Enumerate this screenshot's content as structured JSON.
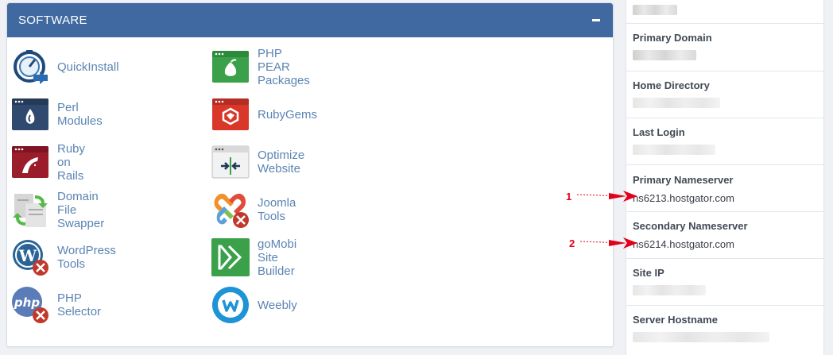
{
  "software": {
    "title": "SOFTWARE",
    "apps": [
      {
        "label": "QuickInstall",
        "icon": "quickinstall-icon"
      },
      {
        "label": "PHP PEAR Packages",
        "icon": "php-pear-icon"
      },
      {
        "label": "Perl Modules",
        "icon": "perl-modules-icon"
      },
      {
        "label": "RubyGems",
        "icon": "rubygems-icon"
      },
      {
        "label": "Ruby on Rails",
        "icon": "ruby-on-rails-icon"
      },
      {
        "label": "Optimize Website",
        "icon": "optimize-website-icon"
      },
      {
        "label": "Domain File Swapper",
        "icon": "domain-file-swapper-icon"
      },
      {
        "label": "Joomla Tools",
        "icon": "joomla-tools-icon"
      },
      {
        "label": "WordPress Tools",
        "icon": "wordpress-tools-icon"
      },
      {
        "label": "goMobi Site Builder",
        "icon": "gomobi-icon"
      },
      {
        "label": "PHP Selector",
        "icon": "php-selector-icon"
      },
      {
        "label": "Weebly",
        "icon": "weebly-icon"
      }
    ]
  },
  "stats": {
    "primary_domain": {
      "label": "Primary Domain"
    },
    "home_directory": {
      "label": "Home Directory"
    },
    "last_login": {
      "label": "Last Login"
    },
    "primary_nameserver": {
      "label": "Primary Nameserver",
      "value": "ns6213.hostgator.com"
    },
    "secondary_nameserver": {
      "label": "Secondary Nameserver",
      "value": "ns6214.hostgator.com"
    },
    "site_ip": {
      "label": "Site IP"
    },
    "server_hostname": {
      "label": "Server Hostname"
    }
  },
  "annotations": [
    {
      "number": "1"
    },
    {
      "number": "2"
    }
  ],
  "colors": {
    "header": "#3f69a0",
    "link": "#5b84b3",
    "annotation": "#e3001b"
  }
}
